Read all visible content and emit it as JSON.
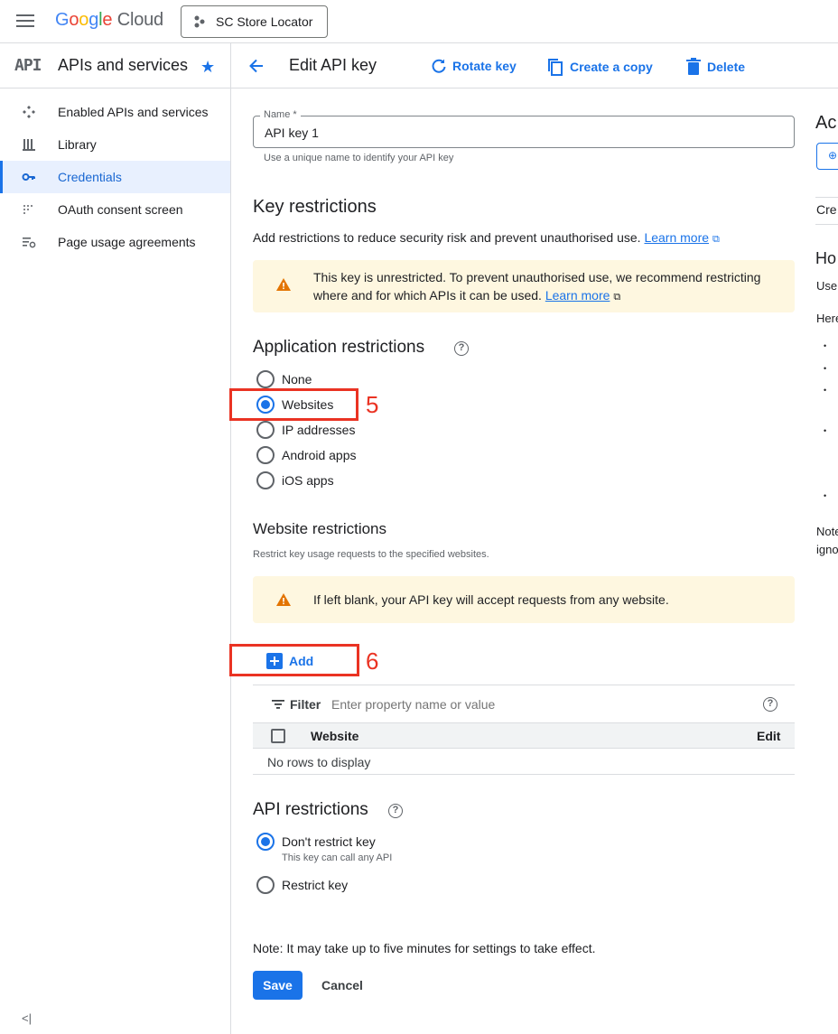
{
  "topbar": {
    "logo_google": "Google",
    "logo_cloud": "Cloud",
    "project": "SC Store Locator"
  },
  "sidebar": {
    "api_badge": "API",
    "title": "APIs and services",
    "items": [
      {
        "label": "Enabled APIs and services",
        "icon": "enabled-apis-icon"
      },
      {
        "label": "Library",
        "icon": "library-icon"
      },
      {
        "label": "Credentials",
        "icon": "key-icon",
        "active": true
      },
      {
        "label": "OAuth consent screen",
        "icon": "oauth-icon"
      },
      {
        "label": "Page usage agreements",
        "icon": "agreements-icon"
      }
    ],
    "collapse": "<|"
  },
  "actionbar": {
    "title": "Edit API key",
    "rotate": "Rotate key",
    "copy": "Create a copy",
    "delete": "Delete"
  },
  "form": {
    "name_label": "Name *",
    "name_value": "API key 1",
    "name_hint": "Use a unique name to identify your API key"
  },
  "key_restrictions": {
    "heading": "Key restrictions",
    "desc": "Add restrictions to reduce security risk and prevent unauthorised use.",
    "learn_more": "Learn more",
    "warning_line1": "This key is unrestricted. To prevent unauthorised use, we recommend restricting",
    "warning_line2": "where and for which APIs it can be used.",
    "warning_link": "Learn more"
  },
  "application_restrictions": {
    "heading": "Application restrictions",
    "options": [
      "None",
      "Websites",
      "IP addresses",
      "Android apps",
      "iOS apps"
    ],
    "selected": "Websites",
    "annotation": "5"
  },
  "website_restrictions": {
    "heading": "Website restrictions",
    "desc": "Restrict key usage requests to the specified websites.",
    "warning": "If left blank, your API key will accept requests from any website.",
    "add": "Add",
    "annotation": "6",
    "filter_label": "Filter",
    "filter_placeholder": "Enter property name or value",
    "col_website": "Website",
    "col_edit": "Edit",
    "empty": "No rows to display"
  },
  "api_restrictions": {
    "heading": "API restrictions",
    "option1": "Don't restrict key",
    "option1_hint": "This key can call any API",
    "option2": "Restrict key",
    "selected": "Don't restrict key"
  },
  "footer": {
    "note": "Note: It may take up to five minutes for settings to take effect.",
    "save": "Save",
    "cancel": "Cancel"
  },
  "right_panel": {
    "heading1": "Ac",
    "line1": "Cre",
    "heading2": "Ho",
    "line2": "Use",
    "line3": "Here",
    "line4": "Note",
    "line5": "igno"
  },
  "colors": {
    "accent": "#1a73e8",
    "warning_bg": "#fef7e0",
    "warning_icon": "#e37400",
    "annotation": "#ea3323"
  }
}
